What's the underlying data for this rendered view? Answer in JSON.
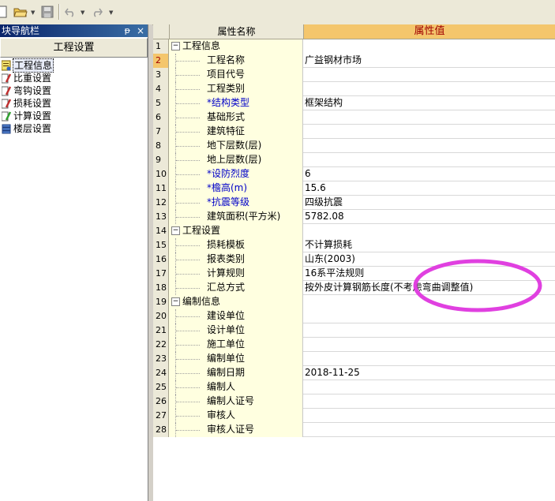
{
  "left_panel": {
    "title": "块导航栏",
    "pin_glyph": "ᵽ",
    "close_glyph": "×",
    "header_button": "工程设置",
    "items": [
      {
        "label": "工程信息",
        "icon": "info-icon",
        "selected": true
      },
      {
        "label": "比重设置",
        "icon": "pencil-icon",
        "selected": false
      },
      {
        "label": "弯钩设置",
        "icon": "pencil-icon",
        "selected": false
      },
      {
        "label": "损耗设置",
        "icon": "pencil-icon",
        "selected": false
      },
      {
        "label": "计算设置",
        "icon": "calc-icon",
        "selected": false
      },
      {
        "label": "楼层设置",
        "icon": "floors-icon",
        "selected": false
      }
    ]
  },
  "grid": {
    "col_name_header": "属性名称",
    "col_value_header": "属性值",
    "rows": [
      {
        "num": "1",
        "name": "工程信息",
        "value": "",
        "group": true
      },
      {
        "num": "2",
        "name": "工程名称",
        "value": "广益钢材市场",
        "current": true
      },
      {
        "num": "3",
        "name": "项目代号",
        "value": ""
      },
      {
        "num": "4",
        "name": "工程类别",
        "value": ""
      },
      {
        "num": "5",
        "name": "*结构类型",
        "value": "框架结构",
        "required": true
      },
      {
        "num": "6",
        "name": "基础形式",
        "value": ""
      },
      {
        "num": "7",
        "name": "建筑特征",
        "value": ""
      },
      {
        "num": "8",
        "name": "地下层数(层)",
        "value": ""
      },
      {
        "num": "9",
        "name": "地上层数(层)",
        "value": ""
      },
      {
        "num": "10",
        "name": "*设防烈度",
        "value": "6",
        "required": true
      },
      {
        "num": "11",
        "name": "*檐高(m)",
        "value": "15.6",
        "required": true
      },
      {
        "num": "12",
        "name": "*抗震等级",
        "value": "四级抗震",
        "required": true
      },
      {
        "num": "13",
        "name": "建筑面积(平方米)",
        "value": "5782.08"
      },
      {
        "num": "14",
        "name": "工程设置",
        "value": "",
        "group": true
      },
      {
        "num": "15",
        "name": "损耗模板",
        "value": "不计算损耗"
      },
      {
        "num": "16",
        "name": "报表类别",
        "value": "山东(2003)"
      },
      {
        "num": "17",
        "name": "计算规则",
        "value": "16系平法规则"
      },
      {
        "num": "18",
        "name": "汇总方式",
        "value": "按外皮计算钢筋长度(不考虑弯曲调整值)"
      },
      {
        "num": "19",
        "name": "编制信息",
        "value": "",
        "group": true
      },
      {
        "num": "20",
        "name": "建设单位",
        "value": ""
      },
      {
        "num": "21",
        "name": "设计单位",
        "value": ""
      },
      {
        "num": "22",
        "name": "施工单位",
        "value": ""
      },
      {
        "num": "23",
        "name": "编制单位",
        "value": ""
      },
      {
        "num": "24",
        "name": "编制日期",
        "value": "2018-11-25"
      },
      {
        "num": "25",
        "name": "编制人",
        "value": ""
      },
      {
        "num": "26",
        "name": "编制人证号",
        "value": ""
      },
      {
        "num": "27",
        "name": "审核人",
        "value": ""
      },
      {
        "num": "28",
        "name": "审核人证号",
        "value": ""
      }
    ]
  },
  "annotation": {
    "color": "#e040e0"
  },
  "colors": {
    "header_value_bg": "#f4c66c",
    "header_value_text": "#a00000",
    "required_text": "#0000c8",
    "title_bar": "#0a246a"
  }
}
